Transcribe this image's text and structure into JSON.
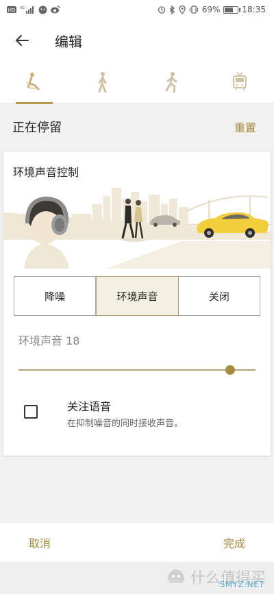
{
  "status_bar": {
    "left_badges": [
      "HD",
      "4G"
    ],
    "battery": "69%",
    "time": "18:35",
    "battery_level": 0.69
  },
  "app_bar": {
    "title": "编辑",
    "back_icon": "arrow-left-icon"
  },
  "mode_tabs": [
    {
      "icon": "sitting-person-icon",
      "selected": true
    },
    {
      "icon": "walking-person-icon",
      "selected": false
    },
    {
      "icon": "running-person-icon",
      "selected": false
    },
    {
      "icon": "bus-icon",
      "selected": false
    }
  ],
  "section": {
    "title": "正在停留",
    "reset_label": "重置"
  },
  "card": {
    "title": "环境声音控制",
    "modes": [
      "降噪",
      "环境声音",
      "关闭"
    ],
    "selected_mode": "环境声音",
    "slider_label": "环境声音 18",
    "slider_value_fraction": 0.91,
    "focus_voice_title": "关注语音",
    "focus_voice_desc": "在抑制噪音的同时接收声音。",
    "focus_voice_checked": false
  },
  "footer": {
    "cancel_label": "取消",
    "done_label": "完成"
  },
  "watermark": {
    "text": "什么值得买",
    "sub": "SMYZ.NET"
  },
  "colors": {
    "accent": "#a58a3e",
    "segment_selected_bg": "#f4efe3",
    "background": "#f1f1f1"
  }
}
